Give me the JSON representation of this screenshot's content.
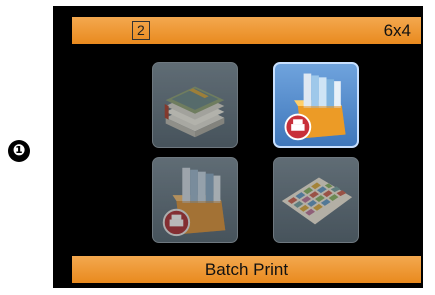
{
  "callout": {
    "label": "❶"
  },
  "header": {
    "count": "2",
    "print_size": "6x4"
  },
  "menu": {
    "items": [
      {
        "icon": "photo-stack-icon",
        "selected": false
      },
      {
        "icon": "batch-print-icon",
        "selected": true
      },
      {
        "icon": "batch-print-icon",
        "selected": false
      },
      {
        "icon": "index-print-icon",
        "selected": false
      }
    ]
  },
  "footer": {
    "title": "Batch Print"
  },
  "colors": {
    "bar": "#e98a1e",
    "screen": "#000000",
    "selected_tile": "#4f86cc"
  }
}
